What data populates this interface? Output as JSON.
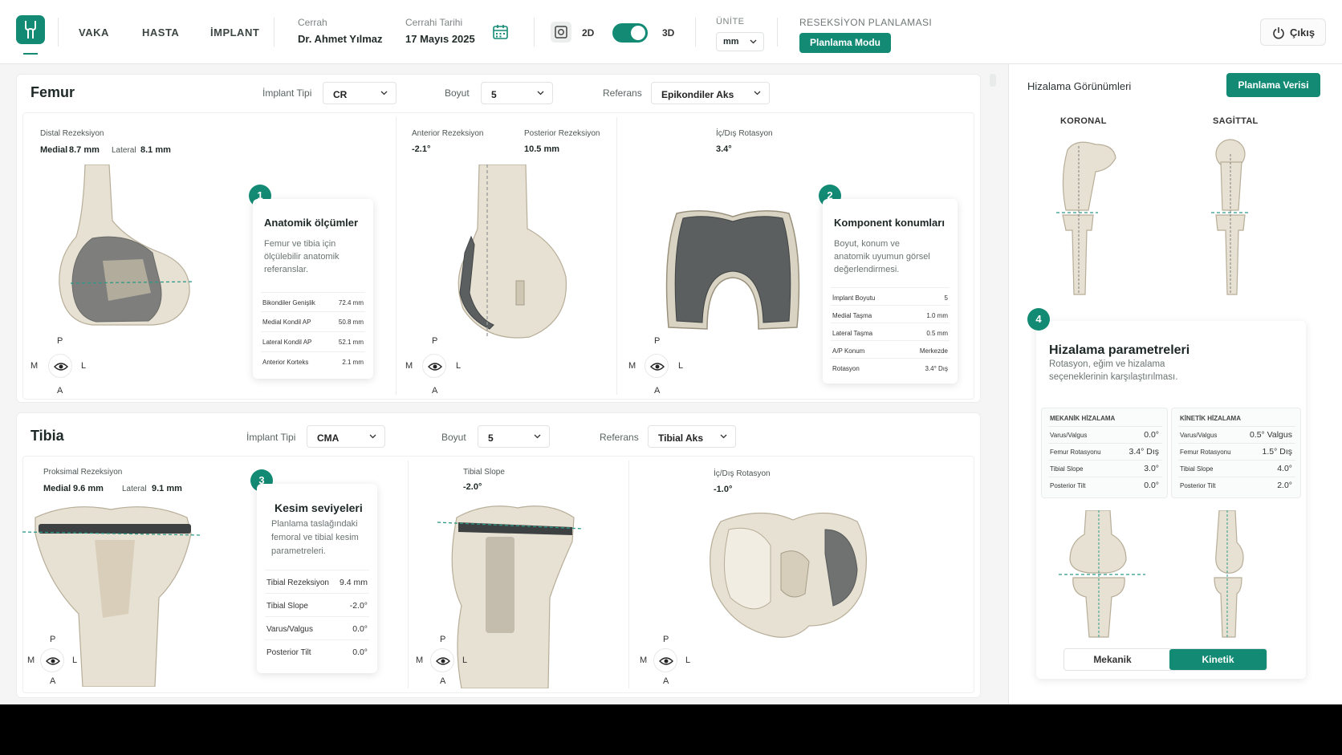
{
  "header": {
    "nav": [
      "VAKA",
      "HASTA",
      "İMPLANT"
    ],
    "surgeon_label": "Cerrah",
    "surgeon_value": "Dr. Ahmet Yılmaz",
    "date_label": "Cerrahi Tarihi",
    "date_value": "17 Mayıs 2025",
    "mode_2d": "2D",
    "mode_3d": "3D",
    "unit_label": "ÜNİTE",
    "unit_value": "mm",
    "resection_label": "RESEKSİYON PLANLAMASI",
    "planning_mode_button": "Planlama Modu",
    "exit_button": "Çıkış",
    "accent_color": "#138a74"
  },
  "femur": {
    "title": "Femur",
    "implant_type_label": "İmplant Tipi",
    "implant_type_value": "CR",
    "size_label": "Boyut",
    "size_value": "5",
    "reference_label": "Referans",
    "reference_value": "Epikondiler Aks",
    "distal": {
      "label": "Distal Rezeksiyon",
      "medial_label": "Medial",
      "medial_value": "8.7 mm",
      "lateral_label": "Lateral",
      "lateral_value": "8.1 mm"
    },
    "anterior": {
      "label": "Anterior Rezeksiyon",
      "value": "-2.1°"
    },
    "posterior": {
      "label": "Posterior Rezeksiyon",
      "value": "10.5 mm"
    },
    "rotation": {
      "label": "İç/Dış Rotasyon",
      "value": "3.4°"
    },
    "callout1": {
      "number": "1",
      "title": "Anatomik ölçümler",
      "desc_lines": [
        "Femur ve tibia için",
        "ölçülebilir anatomik",
        "referanslar."
      ],
      "rows": [
        {
          "label": "Bikondiler Genişlik",
          "value": "72.4 mm"
        },
        {
          "label": "Medial Kondil AP",
          "value": "50.8 mm"
        },
        {
          "label": "Lateral Kondil AP",
          "value": "52.1 mm"
        },
        {
          "label": "Anterior Korteks",
          "value": "2.1 mm"
        }
      ]
    },
    "callout2": {
      "number": "2",
      "title": "Komponent konumları",
      "desc_lines": [
        "Boyut, konum ve",
        "anatomik uyumun görsel",
        "değerlendirmesi."
      ],
      "rows": [
        {
          "label": "İmplant Boyutu",
          "value": "5"
        },
        {
          "label": "Medial Taşma",
          "value": "1.0 mm"
        },
        {
          "label": "Lateral Taşma",
          "value": "0.5 mm"
        },
        {
          "label": "A/P Konum",
          "value": "Merkezde"
        },
        {
          "label": "Rotasyon",
          "value": "3.4° Dış"
        }
      ]
    }
  },
  "tibia": {
    "title": "Tibia",
    "implant_type_label": "İmplant Tipi",
    "implant_type_value": "CMA",
    "size_label": "Boyut",
    "size_value": "5",
    "reference_label": "Referans",
    "reference_value": "Tibial Aks",
    "proximal": {
      "label": "Proksimal Rezeksiyon",
      "medial_label": "Medial",
      "medial_value": "9.6 mm",
      "lateral_label": "Lateral",
      "lateral_value": "9.1 mm"
    },
    "slope": {
      "label": "Tibial Slope",
      "value": "-2.0°"
    },
    "rotation": {
      "label": "İç/Dış Rotasyon",
      "value": "-1.0°"
    },
    "callout3": {
      "number": "3",
      "title": "Kesim seviyeleri",
      "desc_lines": [
        "Planlama taslağındaki",
        "femoral ve tibial kesim",
        "parametreleri."
      ],
      "rows": [
        {
          "label": "Tibial Rezeksiyon",
          "value": "9.4 mm"
        },
        {
          "label": "Tibial Slope",
          "value": "-2.0°"
        },
        {
          "label": "Varus/Valgus",
          "value": "0.0°"
        },
        {
          "label": "Posterior Tilt",
          "value": "0.0°"
        }
      ]
    }
  },
  "orientation": {
    "p": "P",
    "a": "A",
    "m": "M",
    "l": "L"
  },
  "alignment_panel": {
    "title": "Hizalama Görünümleri",
    "data_button": "Planlama Verisi",
    "coronal": "KORONAL",
    "sagittal": "SAGİTTAL",
    "card": {
      "number": "4",
      "title": "Hizalama parametreleri",
      "desc_lines": [
        "Rotasyon, eğim ve hizalama",
        "seçeneklerinin karşılaştırılması."
      ],
      "mechanical": {
        "head": "MEKANİK HİZALAMA",
        "rows": [
          {
            "label": "Varus/Valgus",
            "value": "0.0°"
          },
          {
            "label": "Femur Rotasyonu",
            "value": "3.4° Dış"
          },
          {
            "label": "Tibial Slope",
            "value": "3.0°"
          },
          {
            "label": "Posterior Tilt",
            "value": "0.0°"
          }
        ]
      },
      "kinematic": {
        "head": "KİNETİK HİZALAMA",
        "rows": [
          {
            "label": "Varus/Valgus",
            "value": "0.5° Valgus"
          },
          {
            "label": "Femur Rotasyonu",
            "value": "1.5° Dış"
          },
          {
            "label": "Tibial Slope",
            "value": "4.0°"
          },
          {
            "label": "Posterior Tilt",
            "value": "2.0°"
          }
        ]
      },
      "seg_mechanical": "Mekanik",
      "seg_kinematic": "Kinetik",
      "selected": "Kinetik"
    }
  }
}
